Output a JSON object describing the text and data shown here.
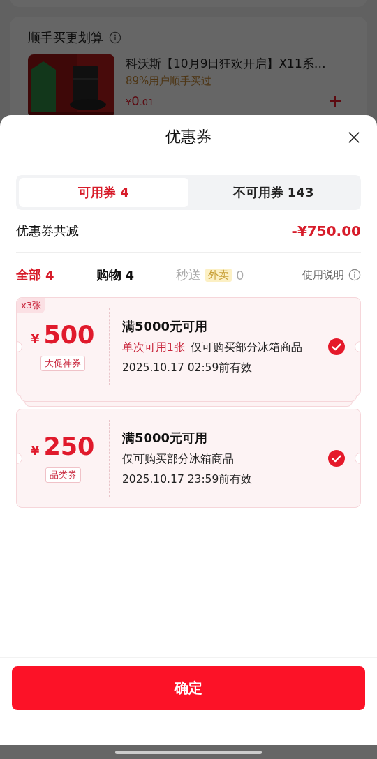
{
  "background_page": {
    "section_title": "顺手买更划算",
    "product": {
      "title": "科沃斯【10月9日狂欢开启】X11系…",
      "note": "89%用户顺手买过",
      "price_symbol": "¥",
      "price_int": "0",
      "price_dec": ".01"
    }
  },
  "sheet": {
    "title": "优惠券"
  },
  "tabs": [
    {
      "label": "可用券",
      "count": "4",
      "selected": true
    },
    {
      "label": "不可用券",
      "count": "143",
      "selected": false
    }
  ],
  "summary": {
    "label": "优惠券共减",
    "amount": "-¥750.00"
  },
  "filters": [
    {
      "label": "全部",
      "count": "4",
      "selected": true,
      "disabled": false
    },
    {
      "label": "购物",
      "count": "4",
      "selected": false,
      "disabled": false
    },
    {
      "label": "秒送",
      "tag": "外卖",
      "count": "0",
      "selected": false,
      "disabled": true
    }
  ],
  "help_link": "使用说明",
  "coupons": [
    {
      "quantity": "x3张",
      "currency": "¥",
      "amount": "500",
      "tag": "大促神券",
      "condition": "满5000元可用",
      "limit": "单次可用1张",
      "scope": "仅可购买部分冰箱商品",
      "expiry": "2025.10.17 02:59前有效",
      "checked": true,
      "stacked": true
    },
    {
      "currency": "¥",
      "amount": "250",
      "tag": "品类券",
      "condition": "满5000元可用",
      "scope": "仅可购买部分冰箱商品",
      "expiry": "2025.10.17 23:59前有效",
      "checked": true,
      "stacked": false
    }
  ],
  "confirm_button": "确定"
}
